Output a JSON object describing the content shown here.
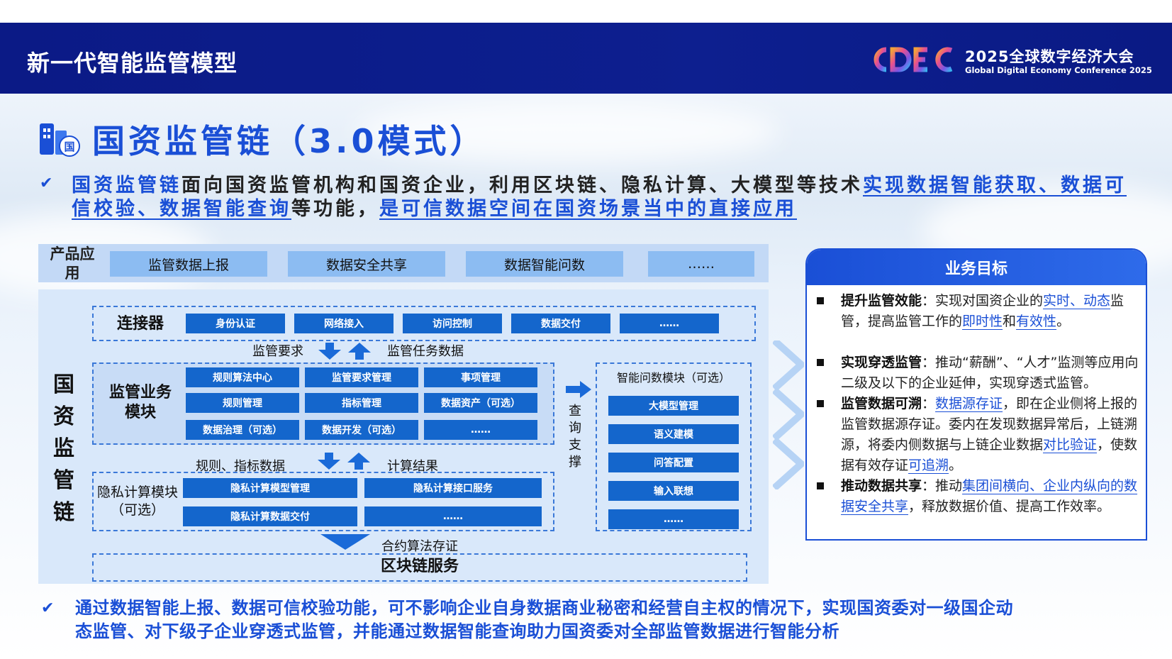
{
  "header": {
    "title": "新一代智能监管模型",
    "conference_cn": "2025全球数字经济大会",
    "conference_en": "Global Digital Economy Conference 2025"
  },
  "section": {
    "icon_glyph": "国",
    "title": "国资监管链（3.0模式）"
  },
  "intro": {
    "p1": "国资监管链",
    "p2": "面向国资监管机构和国资企业，利用区块链、隐私计算、大模型等技术",
    "p3": "实现数据智能获取、数据可信校验、数据智能查询",
    "p4": "等功能，",
    "p5": "是可信数据空间在国资场景当中的直接应用"
  },
  "diagram": {
    "product_label": "产品应用",
    "products": [
      "监管数据上报",
      "数据安全共享",
      "数据智能问数",
      "……"
    ],
    "chain_label": "国资监管链",
    "connector": {
      "label": "连接器",
      "items": [
        "身份认证",
        "网络接入",
        "访问控制",
        "数据交付",
        "……"
      ]
    },
    "arrow1_left": "监管要求",
    "arrow1_right": "监管任务数据",
    "business": {
      "label": "监管业务模块",
      "items": [
        "规则算法中心",
        "监管要求管理",
        "事项管理",
        "规则管理",
        "指标管理",
        "数据资产（可选）",
        "数据治理（可选）",
        "数据开发（可选）",
        "……"
      ]
    },
    "arrow2_left": "规则、指标数据",
    "arrow2_right": "计算结果",
    "privacy": {
      "label": "隐私计算模块（可选）",
      "items": [
        "隐私计算模型管理",
        "隐私计算接口服务",
        "隐私计算数据交付",
        "……"
      ]
    },
    "arrow3_label": "合约算法存证",
    "blockchain_label": "区块链服务",
    "query_label": "查询支撑",
    "qa": {
      "label": "智能问数模块（可选）",
      "items": [
        "大模型管理",
        "语义建模",
        "问答配置",
        "输入联想",
        "……"
      ]
    }
  },
  "goals": {
    "title": "业务目标",
    "items": [
      {
        "bold": "提升监管效能",
        "segments": [
          "：实现对国资企业的",
          "实时、动态",
          "监管，提高监管工作的",
          "即时性",
          "和",
          "有效性",
          "。"
        ]
      },
      {
        "bold": "实现穿透监管",
        "segments": [
          "：推动“薪酬”、“人才”监测等应用向二级及以下的企业延伸，实现穿透式监管。"
        ]
      },
      {
        "bold": "监管数据可溯",
        "segments": [
          "：",
          "数据源存证",
          "，即在企业侧将上报的监管数据源存证。委内在发现数据异常后，上链溯源，将委内侧数据与上链企业数据",
          "对比验证",
          "，使数据有效存证",
          "可追溯",
          "。"
        ]
      },
      {
        "bold": "推动数据共享",
        "segments": [
          "：推动",
          "集团间横向、企业内纵向的数据安全共享",
          "，释放数据价值、提高工作效率。"
        ]
      }
    ]
  },
  "conclusion": {
    "line1": "通过数据智能上报、数据可信校验功能，可不影响企业自身数据商业秘密和经营自主权的情况下，实现国资委对一级国企动",
    "line2": "态监管、对下级子企业穿透式监管，并能通过数据智能查询助力国资委对全部监管数据进行智能分析"
  },
  "colors": {
    "header_bg": "#0d1f8f",
    "accent": "#1a4fd6",
    "module_button": "#1466cc"
  }
}
